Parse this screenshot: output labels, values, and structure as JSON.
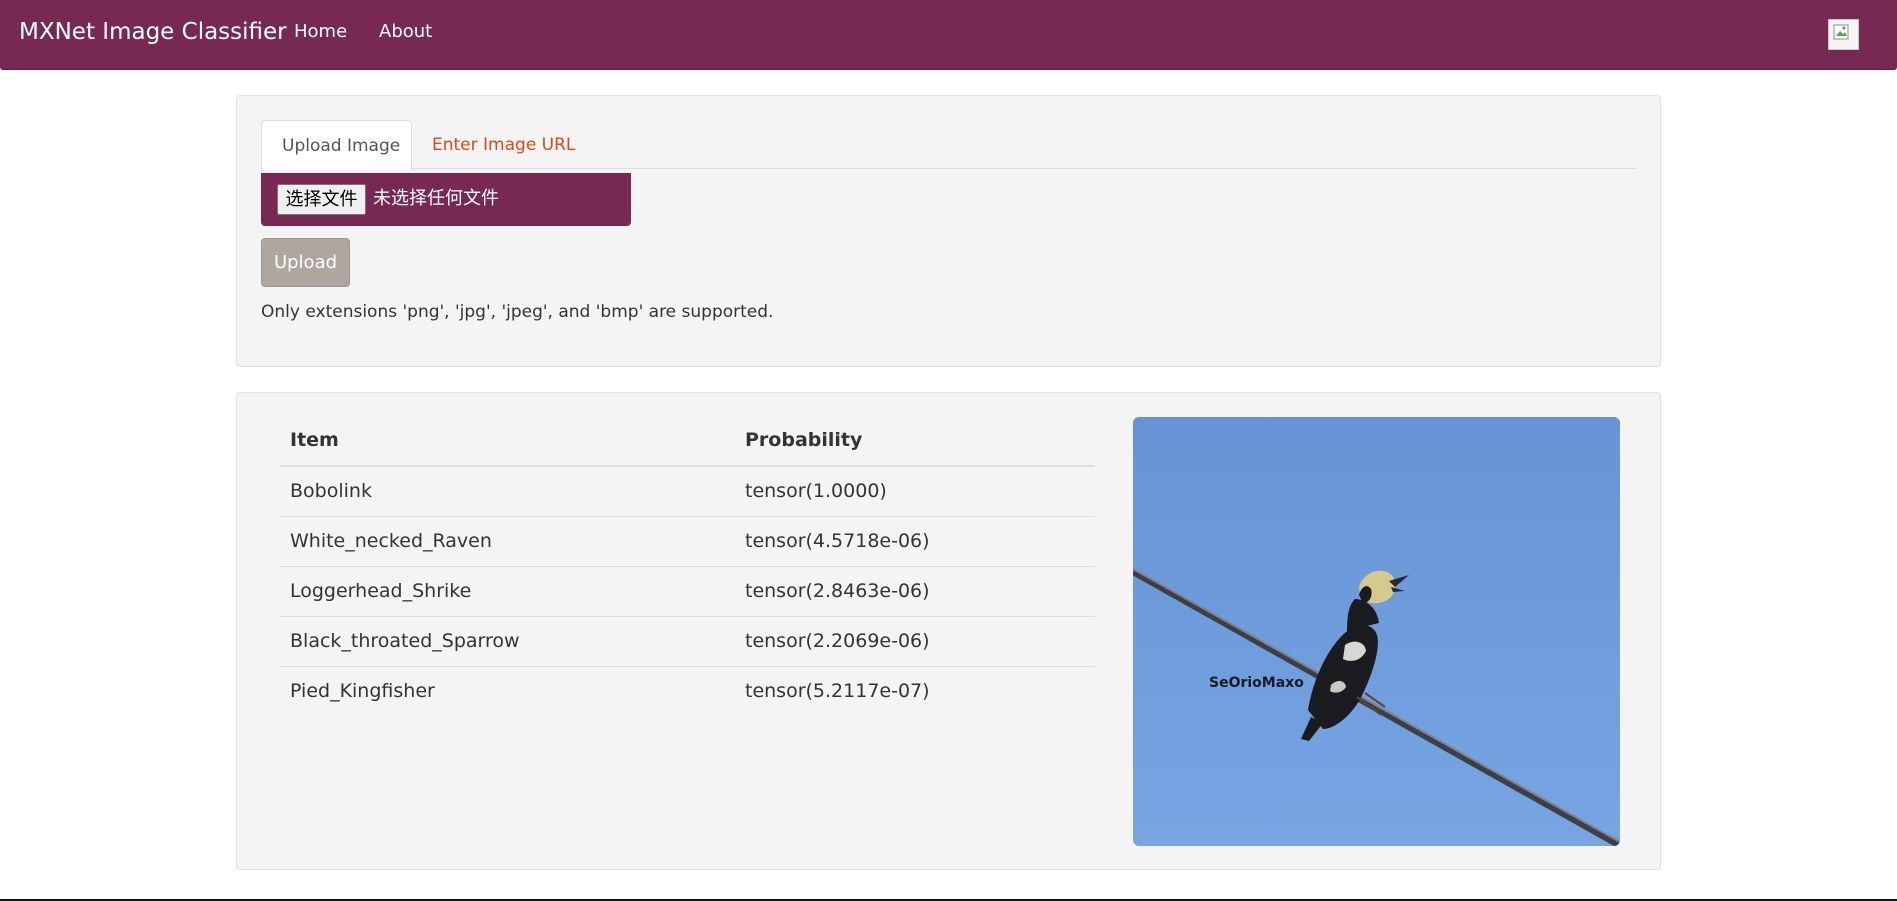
{
  "navbar": {
    "brand": "MXNet Image Classifier",
    "links": [
      "Home",
      "About"
    ],
    "avatar_icon": "broken-image-icon",
    "color": "#772953"
  },
  "upload": {
    "tabs": [
      "Upload Image",
      "Enter Image URL"
    ],
    "active_tab": "Upload Image",
    "file_button_label": "选择文件",
    "file_status": "未选择任何文件",
    "upload_button": "Upload",
    "hint": "Only extensions 'png', 'jpg', 'jpeg', and 'bmp' are supported."
  },
  "results": {
    "columns": [
      "Item",
      "Probability"
    ],
    "rows": [
      {
        "item": "Bobolink",
        "probability": "tensor(1.0000)"
      },
      {
        "item": "White_necked_Raven",
        "probability": "tensor(4.5718e-06)"
      },
      {
        "item": "Loggerhead_Shrike",
        "probability": "tensor(2.8463e-06)"
      },
      {
        "item": "Black_throated_Sparrow",
        "probability": "tensor(2.2069e-06)"
      },
      {
        "item": "Pied_Kingfisher",
        "probability": "tensor(5.2117e-07)"
      }
    ],
    "preview_watermark": "SeOrioMaxo"
  },
  "colors": {
    "primary": "#772953",
    "accent_link": "#dd4814",
    "button_disabled": "#aea79f",
    "well_bg": "#f4f4f4"
  }
}
